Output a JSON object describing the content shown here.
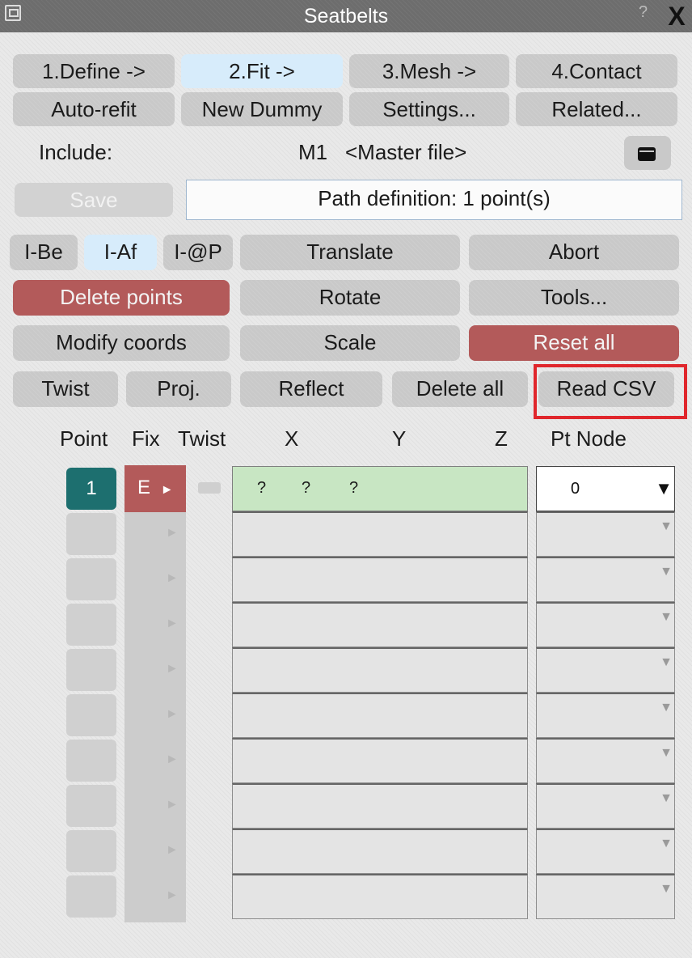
{
  "window": {
    "title": "Seatbelts",
    "close_label": "X",
    "help_label": "?"
  },
  "tabs": [
    "1.Define ->",
    "2.Fit ->",
    "3.Mesh ->",
    "4.Contact"
  ],
  "actions_row": [
    "Auto-refit",
    "New Dummy",
    "Settings...",
    "Related..."
  ],
  "include": {
    "label": "Include:",
    "model": "M1",
    "file": "<Master file>",
    "folder_icon": "folder-icon"
  },
  "save_label": "Save",
  "path_status": "Path definition: 1 point(s)",
  "insert_modes": [
    "I-Be",
    "I-Af",
    "I-@P"
  ],
  "buttons": {
    "translate": "Translate",
    "abort": "Abort",
    "delete_points": "Delete points",
    "rotate": "Rotate",
    "tools": "Tools...",
    "modify_coords": "Modify coords",
    "scale": "Scale",
    "reset_all": "Reset all",
    "twist": "Twist",
    "proj": "Proj.",
    "reflect": "Reflect",
    "delete_all": "Delete all",
    "read_csv": "Read CSV"
  },
  "table": {
    "headers": {
      "point": "Point",
      "fix": "Fix",
      "twist": "Twist",
      "x": "X",
      "y": "Y",
      "z": "Z",
      "pt_node": "Pt Node"
    },
    "first_row": {
      "point": "1",
      "fix": "E",
      "fix_arrow": "►",
      "x": "?",
      "y": "?",
      "z": "?",
      "pt_node": "0",
      "dropdown_arrow": "▼"
    },
    "empty_row_arrow": "►",
    "empty_dropdown_arrow": "▼"
  },
  "colors": {
    "active_tab": "#d7ecfb",
    "danger": "#b35a5a",
    "point_selected": "#1d6f6f",
    "coords_filled": "#c8e6c3",
    "highlight": "#e0262c"
  }
}
